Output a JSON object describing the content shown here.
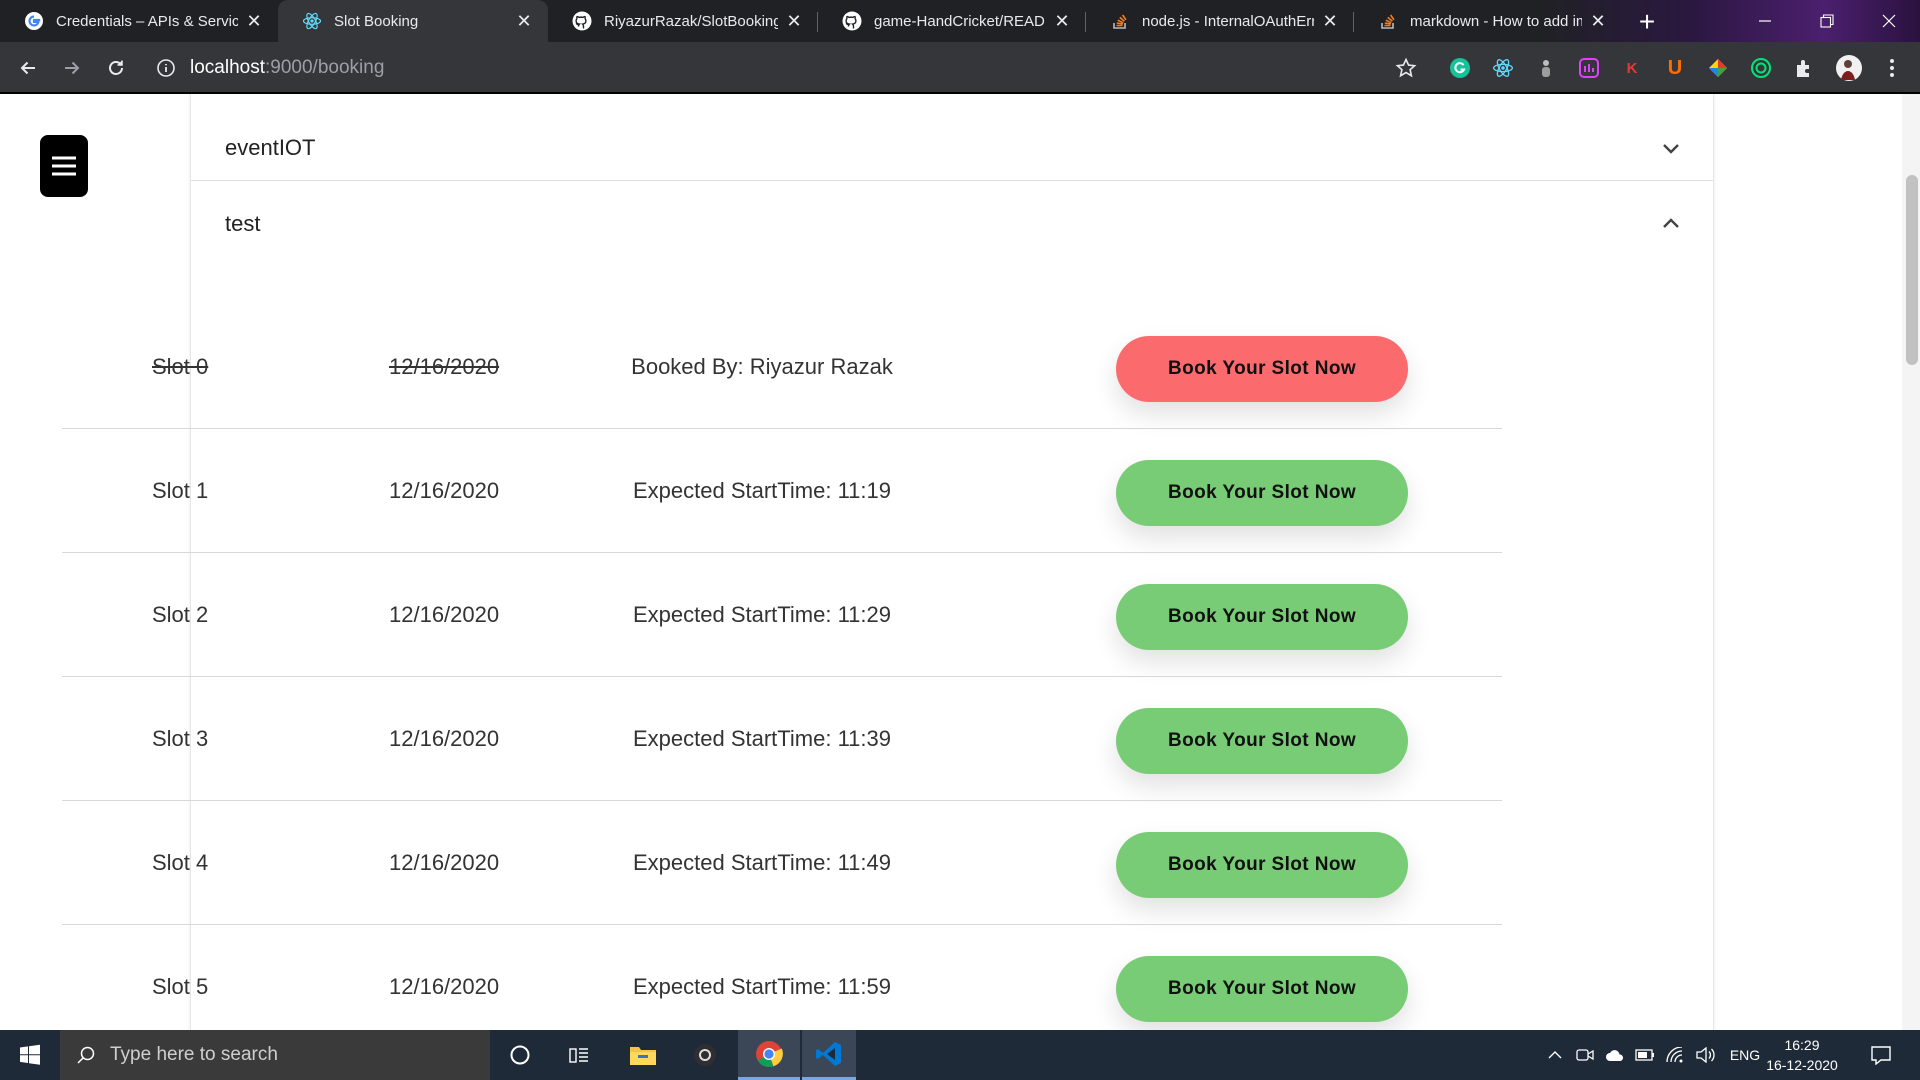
{
  "browser": {
    "tabs": [
      {
        "title": "Credentials – APIs & Services",
        "icon": "google-icon",
        "active": false
      },
      {
        "title": "Slot Booking",
        "icon": "react-icon",
        "active": true
      },
      {
        "title": "RiyazurRazak/SlotBookingApp",
        "icon": "github-icon",
        "active": false
      },
      {
        "title": "game-HandCricket/README.md",
        "icon": "github-icon",
        "active": false
      },
      {
        "title": "node.js - InternalOAuthError",
        "icon": "stackoverflow-icon",
        "active": false
      },
      {
        "title": "markdown - How to add images",
        "icon": "stackoverflow-icon",
        "active": false
      }
    ],
    "close_glyph": "✕",
    "new_tab_glyph": "+",
    "url_host": "localhost",
    "url_rest": ":9000/booking"
  },
  "page": {
    "accordions": [
      {
        "title": "eventIOT",
        "expanded": false
      },
      {
        "title": "test",
        "expanded": true
      }
    ],
    "slots": [
      {
        "name": "Slot 0",
        "date": "12/16/2020",
        "info": "Booked By: Riyazur Razak",
        "booked": true,
        "button": "Book Your Slot Now"
      },
      {
        "name": "Slot 1",
        "date": "12/16/2020",
        "info": "Expected StartTime: 11:19",
        "booked": false,
        "button": "Book Your Slot Now"
      },
      {
        "name": "Slot 2",
        "date": "12/16/2020",
        "info": "Expected StartTime: 11:29",
        "booked": false,
        "button": "Book Your Slot Now"
      },
      {
        "name": "Slot 3",
        "date": "12/16/2020",
        "info": "Expected StartTime: 11:39",
        "booked": false,
        "button": "Book Your Slot Now"
      },
      {
        "name": "Slot 4",
        "date": "12/16/2020",
        "info": "Expected StartTime: 11:49",
        "booked": false,
        "button": "Book Your Slot Now"
      },
      {
        "name": "Slot 5",
        "date": "12/16/2020",
        "info": "Expected StartTime: 11:59",
        "booked": false,
        "button": "Book Your Slot Now"
      }
    ],
    "colors": {
      "available": "#78cc76",
      "booked": "#fb6b6e"
    }
  },
  "taskbar": {
    "search_placeholder": "Type here to search",
    "language": "ENG",
    "time": "16:29",
    "date": "16-12-2020"
  }
}
